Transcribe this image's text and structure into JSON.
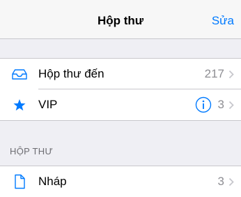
{
  "navbar": {
    "title": "Hộp thư",
    "edit_label": "Sửa"
  },
  "mailboxes": [
    {
      "label": "Hộp thư đến",
      "count": "217",
      "icon": "inbox-tray-icon"
    },
    {
      "label": "VIP",
      "count": "3",
      "icon": "star-icon"
    }
  ],
  "section": {
    "header": "HỘP THƯ"
  },
  "folders": [
    {
      "label": "Nháp",
      "count": "3",
      "icon": "document-icon"
    }
  ],
  "colors": {
    "accent": "#007aff",
    "background": "#efeff4",
    "secondary_text": "#8e8e93"
  }
}
